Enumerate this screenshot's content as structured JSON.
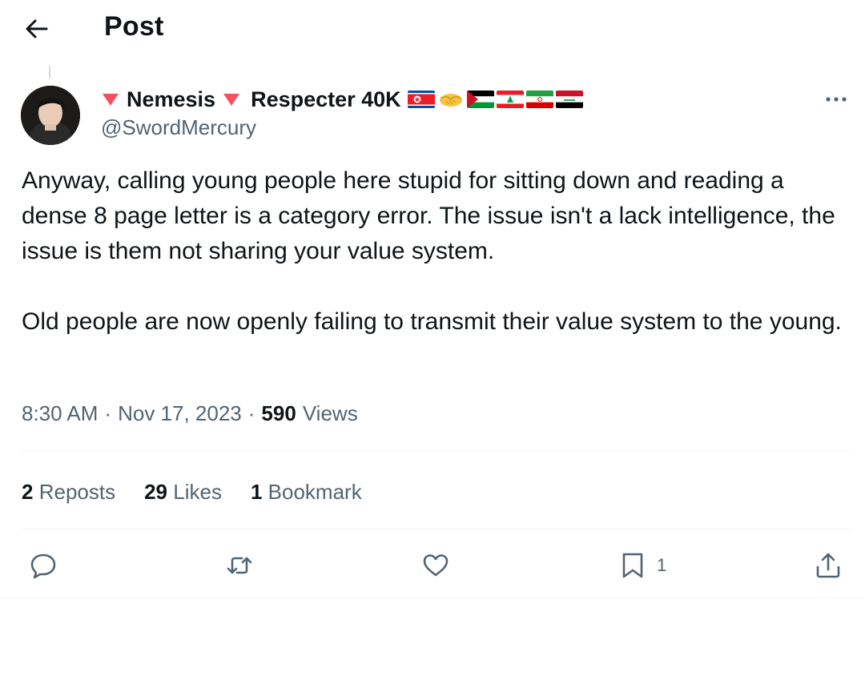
{
  "header": {
    "title": "Post"
  },
  "author": {
    "display_name_part1": "Nemesis",
    "display_name_part2": "Respecter 40K",
    "handle": "@SwordMercury",
    "flags": [
      "flag-north-korea",
      "handshake-emoji",
      "flag-palestine",
      "flag-lebanon",
      "flag-iran",
      "flag-iraq"
    ]
  },
  "post": {
    "text": "Anyway, calling young people here stupid for sitting down and reading a dense 8 page letter is a category error. The issue isn't a lack intelligence, the issue is them not sharing your value system.\n\nOld people are now openly failing to transmit their value system to the young.",
    "time": "8:30 AM",
    "date": "Nov 17, 2023",
    "views_count": "590",
    "views_label": "Views",
    "separator": "·"
  },
  "stats": {
    "reposts_count": "2",
    "reposts_label": "Reposts",
    "likes_count": "29",
    "likes_label": "Likes",
    "bookmarks_count": "1",
    "bookmarks_label": "Bookmark"
  },
  "actions": {
    "bookmark_count": "1"
  },
  "colors": {
    "text": "#0f1419",
    "secondary": "#536471",
    "divider": "#eff3f4",
    "name_triangle": "#f4505e"
  }
}
